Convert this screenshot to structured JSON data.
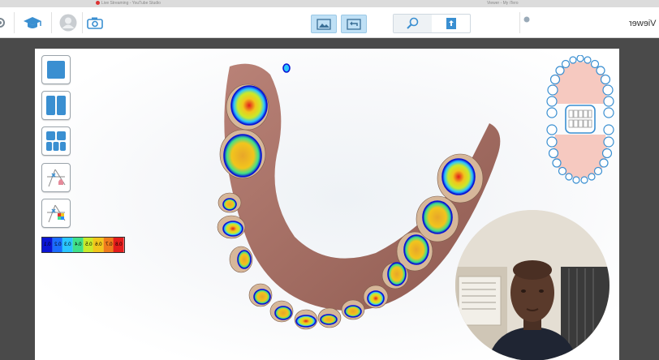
{
  "browser": {
    "tab_left": "Live Streaming - YouTube Studio",
    "tab_right": "Viewer - My iTero"
  },
  "toolbar": {
    "title": "Viewer",
    "icons": [
      "gear-icon",
      "graduation-cap-icon",
      "avatar-icon",
      "camera-icon",
      "image-compare-icon",
      "undo-arrow-icon",
      "magnifier-icon",
      "upload-doc-icon"
    ]
  },
  "sidebar": {
    "buttons": [
      "single-view",
      "dual-view",
      "multi-view",
      "occlusion-tool",
      "occlusion-map-tool"
    ]
  },
  "color_scale": {
    "labels": [
      "0.1",
      "0.2",
      "0.3",
      "0.4",
      "0.5",
      "0.6",
      "0.7",
      "0.8"
    ],
    "colors": [
      "#0a14d4",
      "#1a6cff",
      "#2ac6ff",
      "#3fe08a",
      "#c9ea2a",
      "#f2c51c",
      "#ef7a1c",
      "#e31b1b"
    ]
  },
  "colors": {
    "accent_blue": "#3a8fd1",
    "tooth_chart_pink": "#f6c9c0"
  }
}
